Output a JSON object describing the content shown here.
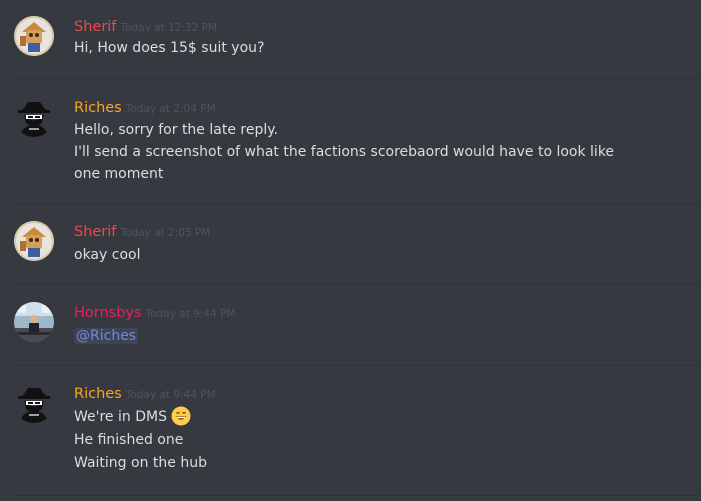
{
  "colors": {
    "background": "#36393f",
    "divider": "#2f3136",
    "text": "#dcddde",
    "timestamp": "#4f545c",
    "mention": "#7289da"
  },
  "messages": [
    {
      "username": "Sherif",
      "username_color": "#f04747",
      "timestamp": "Today at 12:32 PM",
      "avatar_icon": "sherif-avatar-icon",
      "lines": [
        "Hi, How does 15$ suit you?"
      ]
    },
    {
      "username": "Riches",
      "username_color": "#faa61a",
      "timestamp": "Today at 2:04 PM",
      "avatar_icon": "spy-avatar-icon",
      "lines": [
        "Hello, sorry for the late reply.",
        "I'll send a screenshot of what the factions scorebaord would have to look like",
        "one moment"
      ]
    },
    {
      "username": "Sherif",
      "username_color": "#f04747",
      "timestamp": "Today at 2:05 PM",
      "avatar_icon": "sherif-avatar-icon",
      "lines": [
        "okay cool"
      ]
    },
    {
      "username": "Hornsbys",
      "username_color": "#e91e63",
      "timestamp": "Today at 9:44 PM",
      "avatar_icon": "office-avatar-icon",
      "lines": [
        "@Riches"
      ]
    },
    {
      "username": "Riches",
      "username_color": "#faa61a",
      "timestamp": "Today at 9:44 PM",
      "avatar_icon": "spy-avatar-icon",
      "lines": [
        "We're in DMS",
        "He finished one",
        "Waiting on the hub"
      ],
      "emoji": "grinning-face-emoji"
    }
  ]
}
